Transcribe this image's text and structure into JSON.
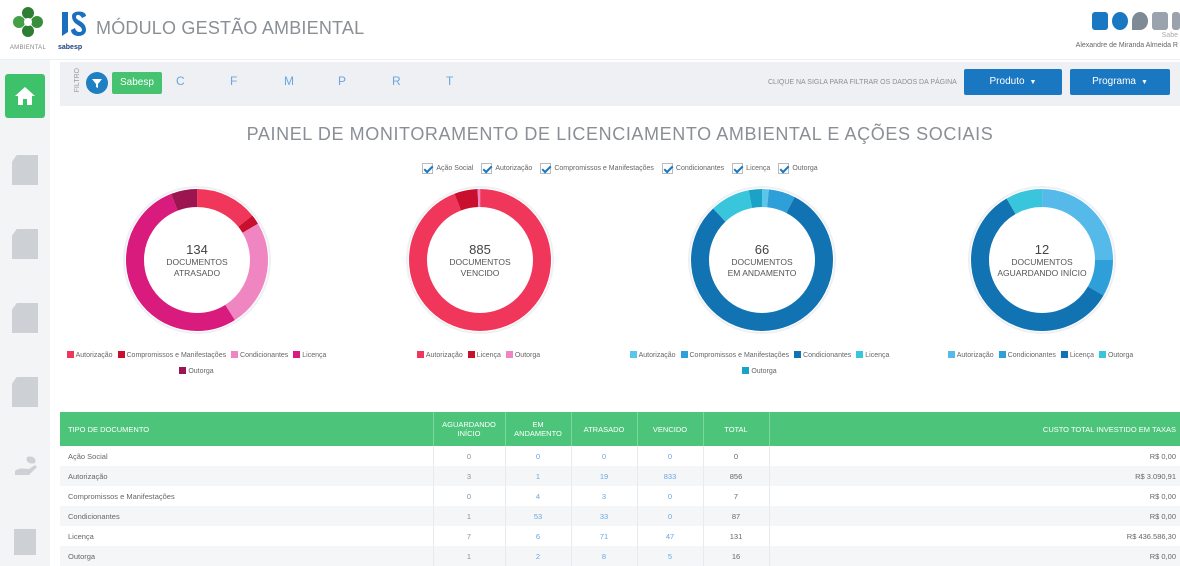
{
  "header": {
    "brand_label": "AMBIENTAL",
    "company_label": "sabesp",
    "title": "MÓDULO GESTÃO AMBIENTAL",
    "user_company": "Sabe",
    "user_name": "Alexandre de Miranda Almeida R"
  },
  "filterbar": {
    "filter_label": "FILTRO",
    "company_tag": "Sabesp",
    "letters": [
      "C",
      "F",
      "M",
      "P",
      "R",
      "T"
    ],
    "hint": "CLIQUE NA SIGLA PARA FILTRAR OS DADOS DA PÁGINA",
    "produto_label": "Produto",
    "programa_label": "Programa"
  },
  "panel": {
    "title": "PAINEL DE MONITORAMENTO DE LICENCIAMENTO AMBIENTAL E AÇÕES SOCIAIS",
    "checkboxes": [
      "Ação Social",
      "Autorização",
      "Compromissos e Manifestações",
      "Condicionantes",
      "Licença",
      "Outorga"
    ]
  },
  "donuts": [
    {
      "number": "134",
      "line1": "DOCUMENTOS",
      "line2": "ATRASADO",
      "segments": [
        {
          "name": "Autorização",
          "value": 19,
          "color": "#f0365a"
        },
        {
          "name": "Compromissos e Manifestações",
          "value": 3,
          "color": "#c8102e"
        },
        {
          "name": "Condicionantes",
          "value": 33,
          "color": "#ef86c2"
        },
        {
          "name": "Licença",
          "value": 71,
          "color": "#d81b7c"
        },
        {
          "name": "Outorga",
          "value": 8,
          "color": "#9c1450"
        }
      ],
      "start_deg": 0
    },
    {
      "number": "885",
      "line1": "DOCUMENTOS",
      "line2": "VENCIDO",
      "segments": [
        {
          "name": "Autorização",
          "value": 833,
          "color": "#f0365a"
        },
        {
          "name": "Licença",
          "value": 47,
          "color": "#c8102e"
        },
        {
          "name": "Outorga",
          "value": 5,
          "color": "#ef86c2"
        }
      ],
      "start_deg": 0
    },
    {
      "number": "66",
      "line1": "DOCUMENTOS",
      "line2": "EM ANDAMENTO",
      "segments": [
        {
          "name": "Autorização",
          "value": 1,
          "color": "#5cc6ea"
        },
        {
          "name": "Compromissos e Manifestações",
          "value": 4,
          "color": "#2e9fd9"
        },
        {
          "name": "Condicionantes",
          "value": 53,
          "color": "#1273b2"
        },
        {
          "name": "Licença",
          "value": 6,
          "color": "#39c6dd"
        },
        {
          "name": "Outorga",
          "value": 2,
          "color": "#1aa3c7"
        }
      ],
      "start_deg": 0
    },
    {
      "number": "12",
      "line1": "DOCUMENTOS",
      "line2": "AGUARDANDO INÍCIO",
      "segments": [
        {
          "name": "Autorização",
          "value": 3,
          "color": "#55b9ea"
        },
        {
          "name": "Condicionantes",
          "value": 1,
          "color": "#2e9fd9"
        },
        {
          "name": "Licença",
          "value": 7,
          "color": "#1273b2"
        },
        {
          "name": "Outorga",
          "value": 1,
          "color": "#39c6dd"
        }
      ],
      "start_deg": 0
    }
  ],
  "legends": [
    [
      {
        "name": "Autorização",
        "color": "#f0365a"
      },
      {
        "name": "Compromissos e Manifestações",
        "color": "#c8102e"
      },
      {
        "name": "Condicionantes",
        "color": "#ef86c2"
      },
      {
        "name": "Licença",
        "color": "#d81b7c"
      },
      {
        "name": "Outorga",
        "color": "#9c1450"
      }
    ],
    [
      {
        "name": "Autorização",
        "color": "#f0365a"
      },
      {
        "name": "Licença",
        "color": "#c8102e"
      },
      {
        "name": "Outorga",
        "color": "#ef86c2"
      }
    ],
    [
      {
        "name": "Autorização",
        "color": "#5cc6ea"
      },
      {
        "name": "Compromissos e Manifestações",
        "color": "#2e9fd9"
      },
      {
        "name": "Condicionantes",
        "color": "#1273b2"
      },
      {
        "name": "Licença",
        "color": "#39c6dd"
      },
      {
        "name": "Outorga",
        "color": "#1aa3c7"
      }
    ],
    [
      {
        "name": "Autorização",
        "color": "#55b9ea"
      },
      {
        "name": "Condicionantes",
        "color": "#2e9fd9"
      },
      {
        "name": "Licença",
        "color": "#1273b2"
      },
      {
        "name": "Outorga",
        "color": "#39c6dd"
      }
    ]
  ],
  "table": {
    "headers": {
      "tipo": "TIPO DE DOCUMENTO",
      "aguardando": [
        "AGUARDANDO",
        "INÍCIO"
      ],
      "andamento": [
        "EM",
        "ANDAMENTO"
      ],
      "atrasado": "ATRASADO",
      "vencido": "VENCIDO",
      "total": "TOTAL",
      "custo": "CUSTO TOTAL INVESTIDO EM TAXAS"
    },
    "rows": [
      {
        "tipo": "Ação Social",
        "aguardando": "0",
        "andamento": "0",
        "atrasado": "0",
        "vencido": "0",
        "total": "0",
        "custo": "R$ 0,00"
      },
      {
        "tipo": "Autorização",
        "aguardando": "3",
        "andamento": "1",
        "atrasado": "19",
        "vencido": "833",
        "total": "856",
        "custo": "R$ 3.090,91"
      },
      {
        "tipo": "Compromissos e Manifestações",
        "aguardando": "0",
        "andamento": "4",
        "atrasado": "3",
        "vencido": "0",
        "total": "7",
        "custo": "R$ 0,00"
      },
      {
        "tipo": "Condicionantes",
        "aguardando": "1",
        "andamento": "53",
        "atrasado": "33",
        "vencido": "0",
        "total": "87",
        "custo": "R$ 0,00"
      },
      {
        "tipo": "Licença",
        "aguardando": "7",
        "andamento": "6",
        "atrasado": "71",
        "vencido": "47",
        "total": "131",
        "custo": "R$ 436.586,30"
      },
      {
        "tipo": "Outorga",
        "aguardando": "1",
        "andamento": "2",
        "atrasado": "8",
        "vencido": "5",
        "total": "16",
        "custo": "R$ 0,00"
      }
    ]
  }
}
